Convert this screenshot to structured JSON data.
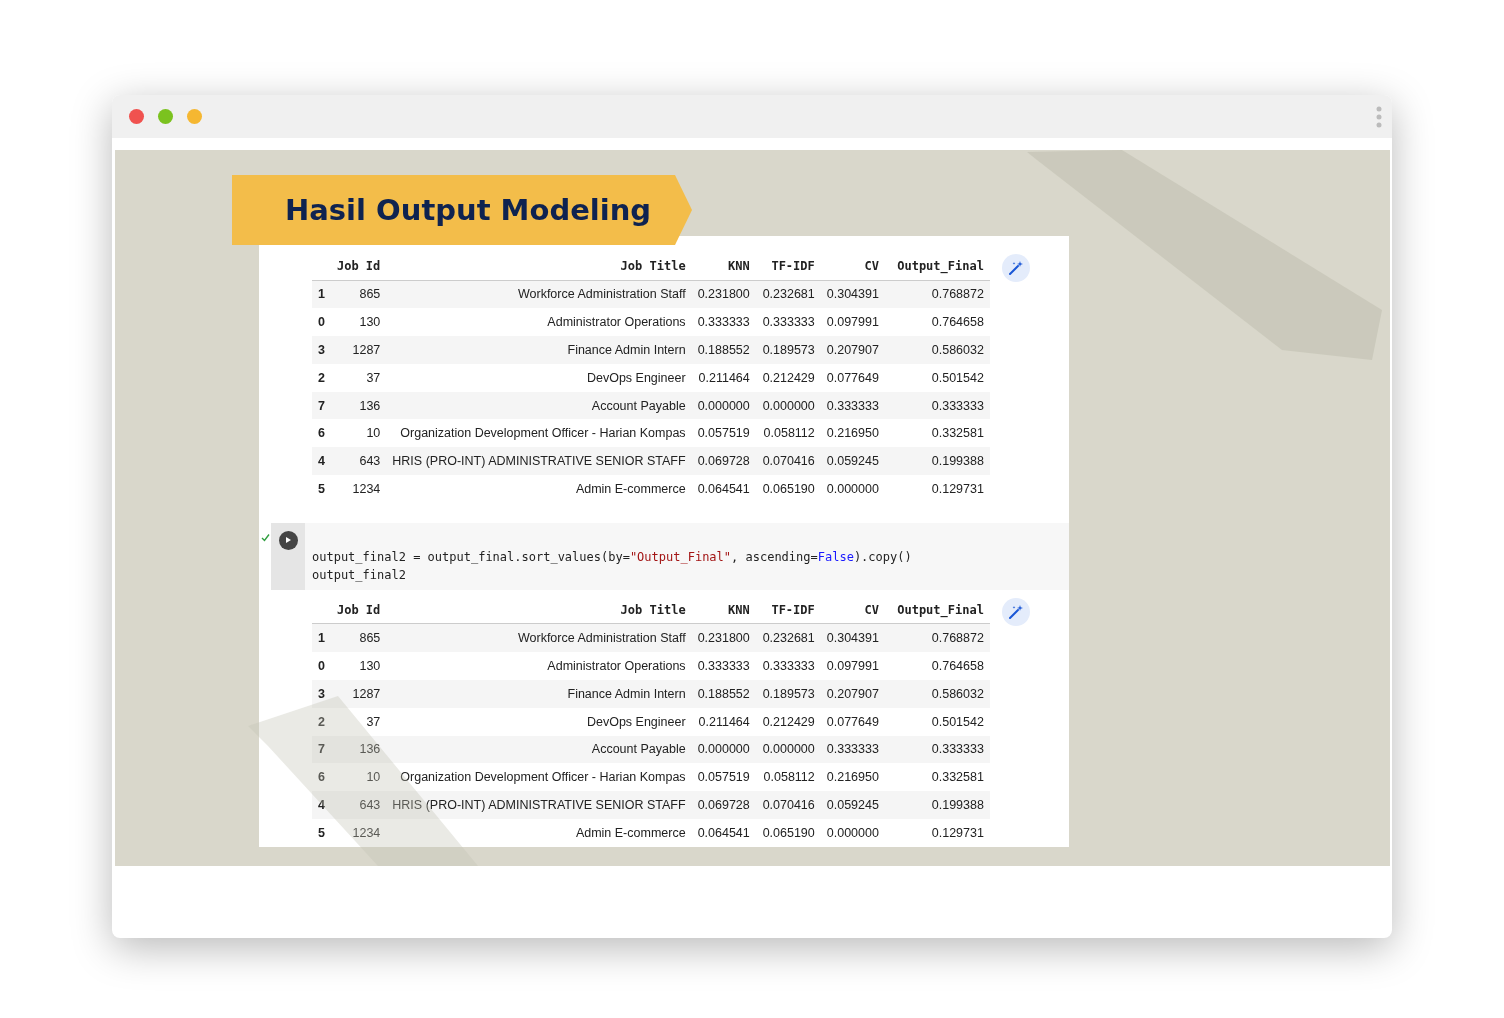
{
  "window": {
    "controls": [
      {
        "color": "#f0524f"
      },
      {
        "color": "#7bc21f"
      },
      {
        "color": "#f5b731"
      }
    ]
  },
  "slide": {
    "title": "Hasil Output Modeling"
  },
  "notebook": [
    {
      "kind": "output",
      "table": {
        "columns": [
          "Job Id",
          "Job Title",
          "KNN",
          "TF-IDF",
          "CV",
          "Output_Final"
        ],
        "rows": [
          {
            "index": "1",
            "cells": [
              "865",
              "Workforce Administration Staff",
              "0.231800",
              "0.232681",
              "0.304391",
              "0.768872"
            ]
          },
          {
            "index": "0",
            "cells": [
              "130",
              "Administrator Operations",
              "0.333333",
              "0.333333",
              "0.097991",
              "0.764658"
            ]
          },
          {
            "index": "3",
            "cells": [
              "1287",
              "Finance Admin Intern",
              "0.188552",
              "0.189573",
              "0.207907",
              "0.586032"
            ]
          },
          {
            "index": "2",
            "cells": [
              "37",
              "DevOps Engineer",
              "0.211464",
              "0.212429",
              "0.077649",
              "0.501542"
            ]
          },
          {
            "index": "7",
            "cells": [
              "136",
              "Account Payable",
              "0.000000",
              "0.000000",
              "0.333333",
              "0.333333"
            ]
          },
          {
            "index": "6",
            "cells": [
              "10",
              "Organization Development Officer - Harian Kompas",
              "0.057519",
              "0.058112",
              "0.216950",
              "0.332581"
            ]
          },
          {
            "index": "4",
            "cells": [
              "643",
              "HRIS (PRO-INT) ADMINISTRATIVE SENIOR STAFF",
              "0.069728",
              "0.070416",
              "0.059245",
              "0.199388"
            ]
          },
          {
            "index": "5",
            "cells": [
              "1234",
              "Admin E-commerce",
              "0.064541",
              "0.065190",
              "0.000000",
              "0.129731"
            ]
          }
        ]
      }
    },
    {
      "kind": "code",
      "executed": true,
      "lines": [
        [
          {
            "kind": "plain",
            "text": "output_final2 = output_final.sort_values(by="
          },
          {
            "kind": "string",
            "text": "\"Output_Final\""
          },
          {
            "kind": "plain",
            "text": ", ascending="
          },
          {
            "kind": "keyword",
            "text": "False"
          },
          {
            "kind": "plain",
            "text": ").copy()"
          }
        ],
        [
          {
            "kind": "plain",
            "text": "output_final2"
          }
        ]
      ]
    },
    {
      "kind": "output",
      "table": {
        "columns": [
          "Job Id",
          "Job Title",
          "KNN",
          "TF-IDF",
          "CV",
          "Output_Final"
        ],
        "rows": [
          {
            "index": "1",
            "cells": [
              "865",
              "Workforce Administration Staff",
              "0.231800",
              "0.232681",
              "0.304391",
              "0.768872"
            ]
          },
          {
            "index": "0",
            "cells": [
              "130",
              "Administrator Operations",
              "0.333333",
              "0.333333",
              "0.097991",
              "0.764658"
            ]
          },
          {
            "index": "3",
            "cells": [
              "1287",
              "Finance Admin Intern",
              "0.188552",
              "0.189573",
              "0.207907",
              "0.586032"
            ]
          },
          {
            "index": "2",
            "cells": [
              "37",
              "DevOps Engineer",
              "0.211464",
              "0.212429",
              "0.077649",
              "0.501542"
            ]
          },
          {
            "index": "7",
            "cells": [
              "136",
              "Account Payable",
              "0.000000",
              "0.000000",
              "0.333333",
              "0.333333"
            ]
          },
          {
            "index": "6",
            "cells": [
              "10",
              "Organization Development Officer - Harian Kompas",
              "0.057519",
              "0.058112",
              "0.216950",
              "0.332581"
            ]
          },
          {
            "index": "4",
            "cells": [
              "643",
              "HRIS (PRO-INT) ADMINISTRATIVE SENIOR STAFF",
              "0.069728",
              "0.070416",
              "0.059245",
              "0.199388"
            ]
          },
          {
            "index": "5",
            "cells": [
              "1234",
              "Admin E-commerce",
              "0.064541",
              "0.065190",
              "0.000000",
              "0.129731"
            ]
          }
        ]
      }
    }
  ]
}
